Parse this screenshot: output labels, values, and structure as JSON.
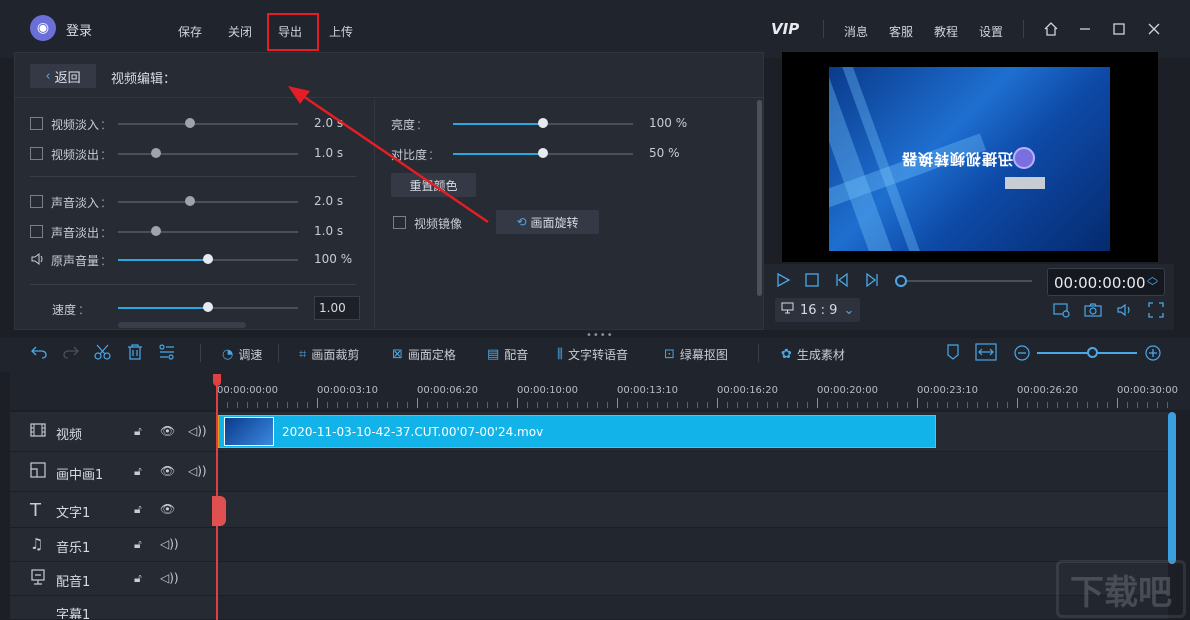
{
  "titlebar": {
    "login": "登录",
    "menu": [
      "保存",
      "关闭",
      "导出",
      "上传"
    ],
    "vip": "VIP",
    "right_menu": [
      "消息",
      "客服",
      "教程",
      "设置"
    ]
  },
  "edit": {
    "back": "返回",
    "title": "视频编辑：",
    "fade_in_video": {
      "label": "视频淡入",
      "value": "2.0 s"
    },
    "fade_out_video": {
      "label": "视频淡出",
      "value": "1.0 s"
    },
    "fade_in_audio": {
      "label": "声音淡入",
      "value": "2.0 s"
    },
    "fade_out_audio": {
      "label": "声音淡出",
      "value": "1.0 s"
    },
    "volume": {
      "label": "原声音量",
      "value": "100 %",
      "level": 1.0
    },
    "speed": {
      "label": "速度",
      "value": "1.00"
    },
    "brightness": {
      "label": "亮度",
      "value": "100 %",
      "level": 1.0
    },
    "contrast": {
      "label": "对比度",
      "value": "50 %",
      "level": 0.5
    },
    "reset_color": "重置颜色",
    "mirror": "视频镜像",
    "rotate": "画面旋转"
  },
  "preview": {
    "overlay_text": "迅捷视频转换器",
    "timecode": "00:00:00:00",
    "ratio": "16 : 9"
  },
  "toolbar": {
    "speed": "调速",
    "crop": "画面裁剪",
    "freeze": "画面定格",
    "dub": "配音",
    "tts": "文字转语音",
    "chroma": "绿幕抠图",
    "generate": "生成素材"
  },
  "ruler": [
    "00:00:00:00",
    "00:00:03:10",
    "00:00:06:20",
    "00:00:10:00",
    "00:00:13:10",
    "00:00:16:20",
    "00:00:20:00",
    "00:00:23:10",
    "00:00:26:20",
    "00:00:30:00"
  ],
  "tracks": [
    "视频",
    "画中画1",
    "文字1",
    "音乐1",
    "配音1",
    "字幕1"
  ],
  "clip": {
    "name": "2020-11-03-10-42-37.CUT.00'07-00'24.mov"
  },
  "watermark": "下载吧"
}
